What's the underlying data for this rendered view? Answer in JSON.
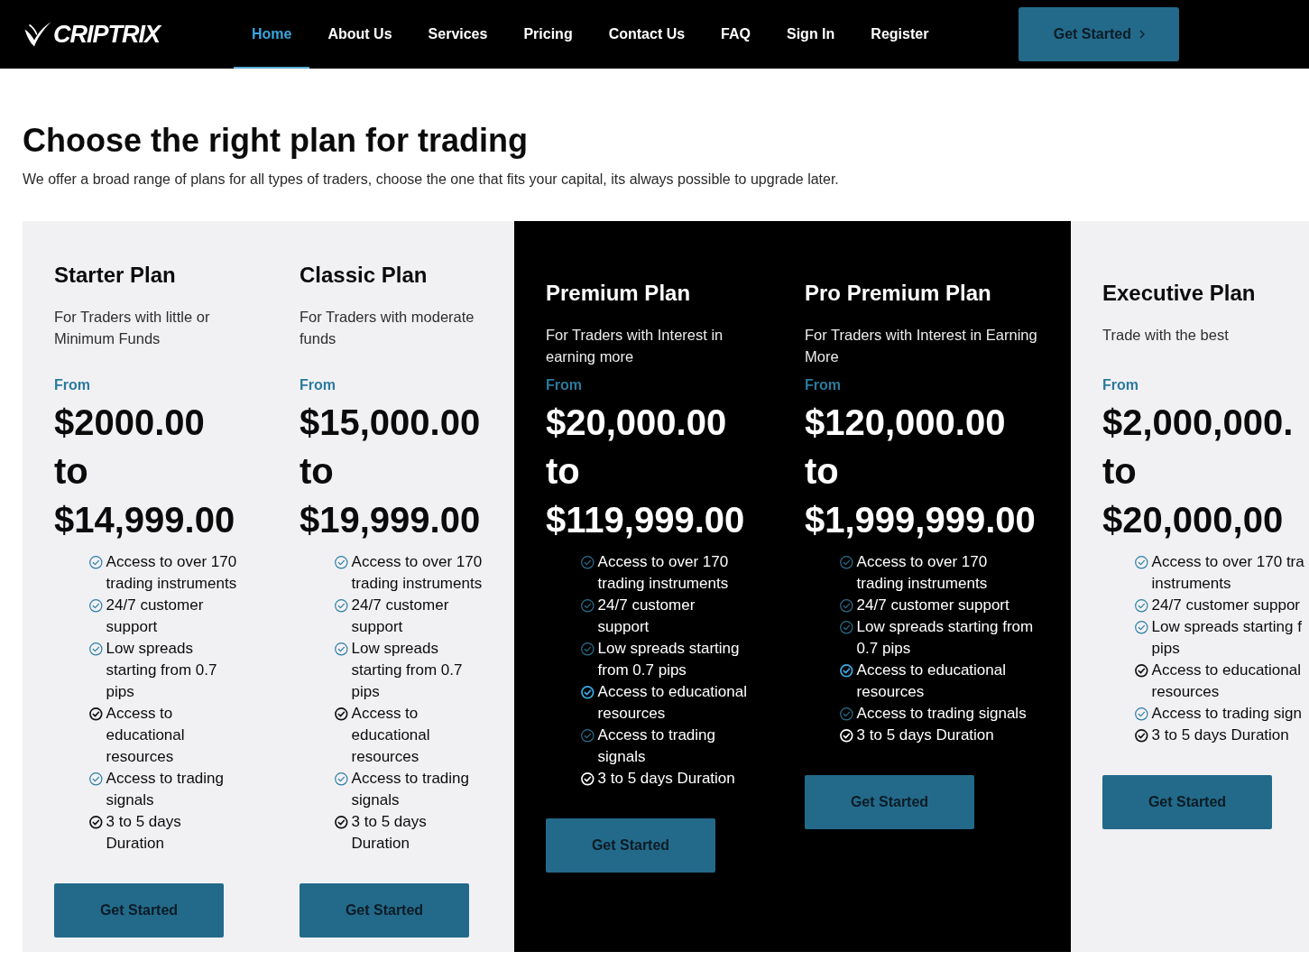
{
  "navbar": {
    "brand": "CRIPTRIX",
    "links": [
      {
        "label": "Home",
        "selected": true
      },
      {
        "label": "About Us",
        "selected": false
      },
      {
        "label": "Services",
        "selected": false
      },
      {
        "label": "Pricing",
        "selected": false
      },
      {
        "label": "Contact Us",
        "selected": false
      },
      {
        "label": "FAQ",
        "selected": false
      },
      {
        "label": "Sign In",
        "selected": false
      },
      {
        "label": "Register",
        "selected": false
      }
    ],
    "cta": "Get Started"
  },
  "header": {
    "title": "Choose the right plan for trading",
    "subtitle": "We offer a broad range of plans for all types of traders, choose the one that fits your capital, its always possible to upgrade later."
  },
  "plans": [
    {
      "kind": "standard",
      "name": "Starter Plan",
      "description": "For Traders with little or Minimum Funds",
      "from_label": "From",
      "price_low": "$2000.00",
      "price_joiner": "to",
      "price_high": "$14,999.00",
      "features": [
        {
          "kind": "accent",
          "text": "Access to over 170 trading instruments"
        },
        {
          "kind": "accent",
          "text": "24/7 customer support"
        },
        {
          "kind": "accent",
          "text": "Low spreads starting from 0.7 pips"
        },
        {
          "kind": "plain",
          "text": "Access to educational resources"
        },
        {
          "kind": "accent",
          "text": "Access to trading signals"
        },
        {
          "kind": "plain",
          "text": "3 to 5 days Duration"
        }
      ],
      "button": "Get Started"
    },
    {
      "kind": "standard",
      "name": "Classic Plan",
      "description": "For Traders with moderate funds",
      "from_label": "From",
      "price_low": "$15,000.00",
      "price_joiner": "to",
      "price_high": "$19,999.00",
      "features": [
        {
          "kind": "accent",
          "text": "Access to over 170 trading instruments"
        },
        {
          "kind": "accent",
          "text": "24/7 customer support"
        },
        {
          "kind": "accent",
          "text": "Low spreads starting from 0.7 pips"
        },
        {
          "kind": "plain",
          "text": "Access to educational resources"
        },
        {
          "kind": "accent",
          "text": "Access to trading signals"
        },
        {
          "kind": "plain",
          "text": "3 to 5 days Duration"
        }
      ],
      "button": "Get Started"
    },
    {
      "kind": "featured",
      "name": "Premium Plan",
      "description": "For Traders with Interest in earning more",
      "from_label": "From",
      "price_low": "$20,000.00",
      "price_joiner": "to",
      "price_high": "$119,999.00",
      "features": [
        {
          "kind": "accent",
          "text": "Access to over 170 trading instruments"
        },
        {
          "kind": "accent",
          "text": "24/7 customer support"
        },
        {
          "kind": "accent",
          "text": "Low spreads starting from 0.7 pips"
        },
        {
          "kind": "strong",
          "text": "Access to educational resources"
        },
        {
          "kind": "accent",
          "text": "Access to trading signals"
        },
        {
          "kind": "plain",
          "text": "3 to 5 days Duration"
        }
      ],
      "button": "Get Started"
    },
    {
      "kind": "featured",
      "name": "Pro Premium Plan",
      "description": "For Traders with Interest in Earning More",
      "from_label": "From",
      "price_low": "$120,000.00",
      "price_joiner": "to",
      "price_high": "$1,999,999.00",
      "features": [
        {
          "kind": "accent",
          "text": "Access to over 170 trading instruments"
        },
        {
          "kind": "accent",
          "text": "24/7 customer support"
        },
        {
          "kind": "accent",
          "text": "Low spreads starting from 0.7 pips"
        },
        {
          "kind": "strong",
          "text": "Access to educational resources"
        },
        {
          "kind": "accent",
          "text": "Access to trading signals"
        },
        {
          "kind": "plain",
          "text": "3 to 5 days Duration"
        }
      ],
      "button": "Get Started"
    },
    {
      "kind": "standard",
      "name": "Executive Plan",
      "description": "Trade with the best",
      "from_label": "From",
      "price_low": "$2,000,000.",
      "price_joiner": "to",
      "price_high": "$20,000,00",
      "features": [
        {
          "kind": "accent",
          "text": "Access to over 170 tra\ninstruments"
        },
        {
          "kind": "accent",
          "text": "24/7 customer suppor"
        },
        {
          "kind": "accent",
          "text": "Low spreads starting f\npips"
        },
        {
          "kind": "plain",
          "text": "Access to educational resources"
        },
        {
          "kind": "accent",
          "text": "Access to trading sign"
        },
        {
          "kind": "plain",
          "text": "3 to 5 days Duration"
        }
      ],
      "button": "Get Started"
    }
  ]
}
